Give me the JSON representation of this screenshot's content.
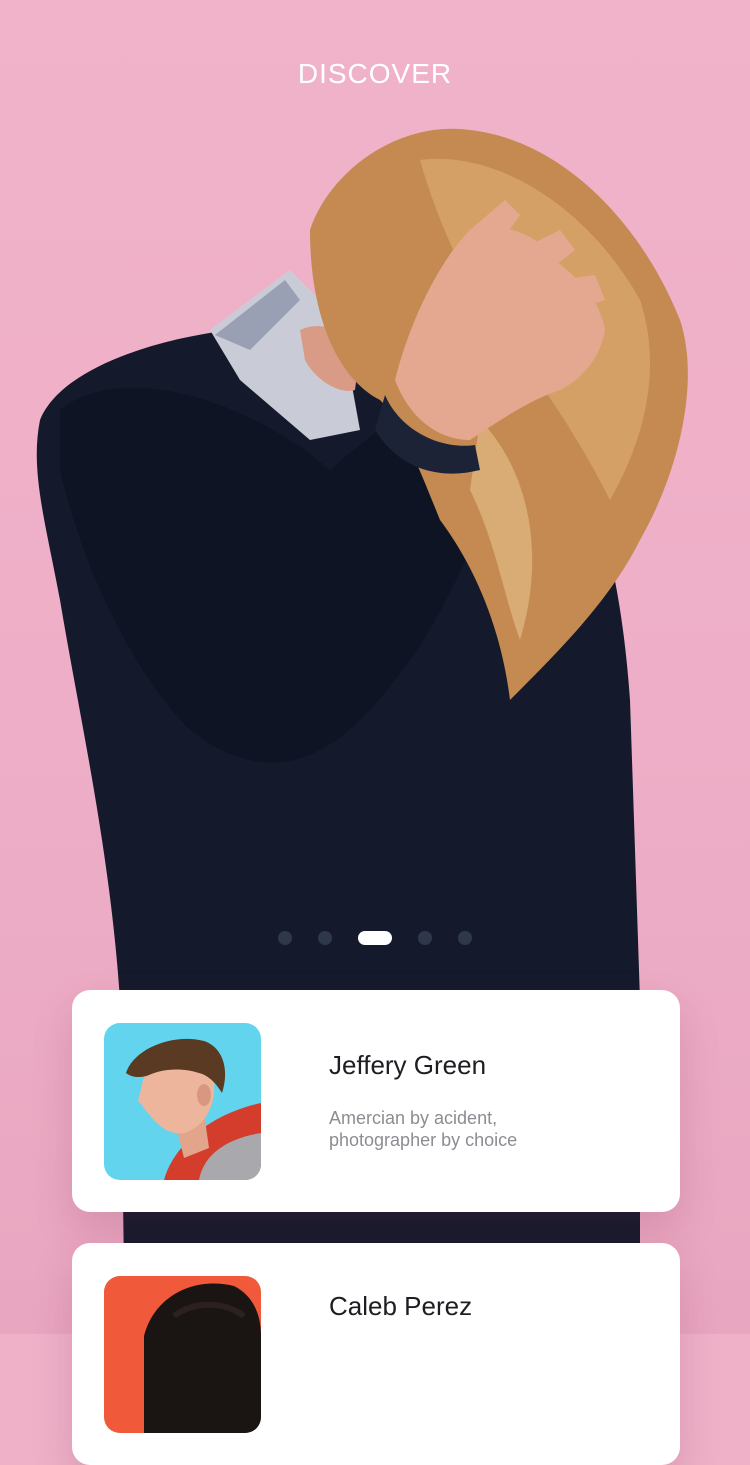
{
  "header": {
    "title": "DISCOVER"
  },
  "pager": {
    "count": 5,
    "active_index": 2
  },
  "profiles": [
    {
      "name": "Jeffery Green",
      "bio_line_1": "Amercian by acident,",
      "bio_line_2": "photographer by choice",
      "avatar_bg": "#62d4ee"
    },
    {
      "name": "Caleb Perez",
      "avatar_bg": "#f05a3a"
    }
  ],
  "colors": {
    "background": "#eeb1c8",
    "sweater": "#141a2c",
    "hair": "#c48a52",
    "card": "#ffffff",
    "active_dot": "#ffffff"
  }
}
